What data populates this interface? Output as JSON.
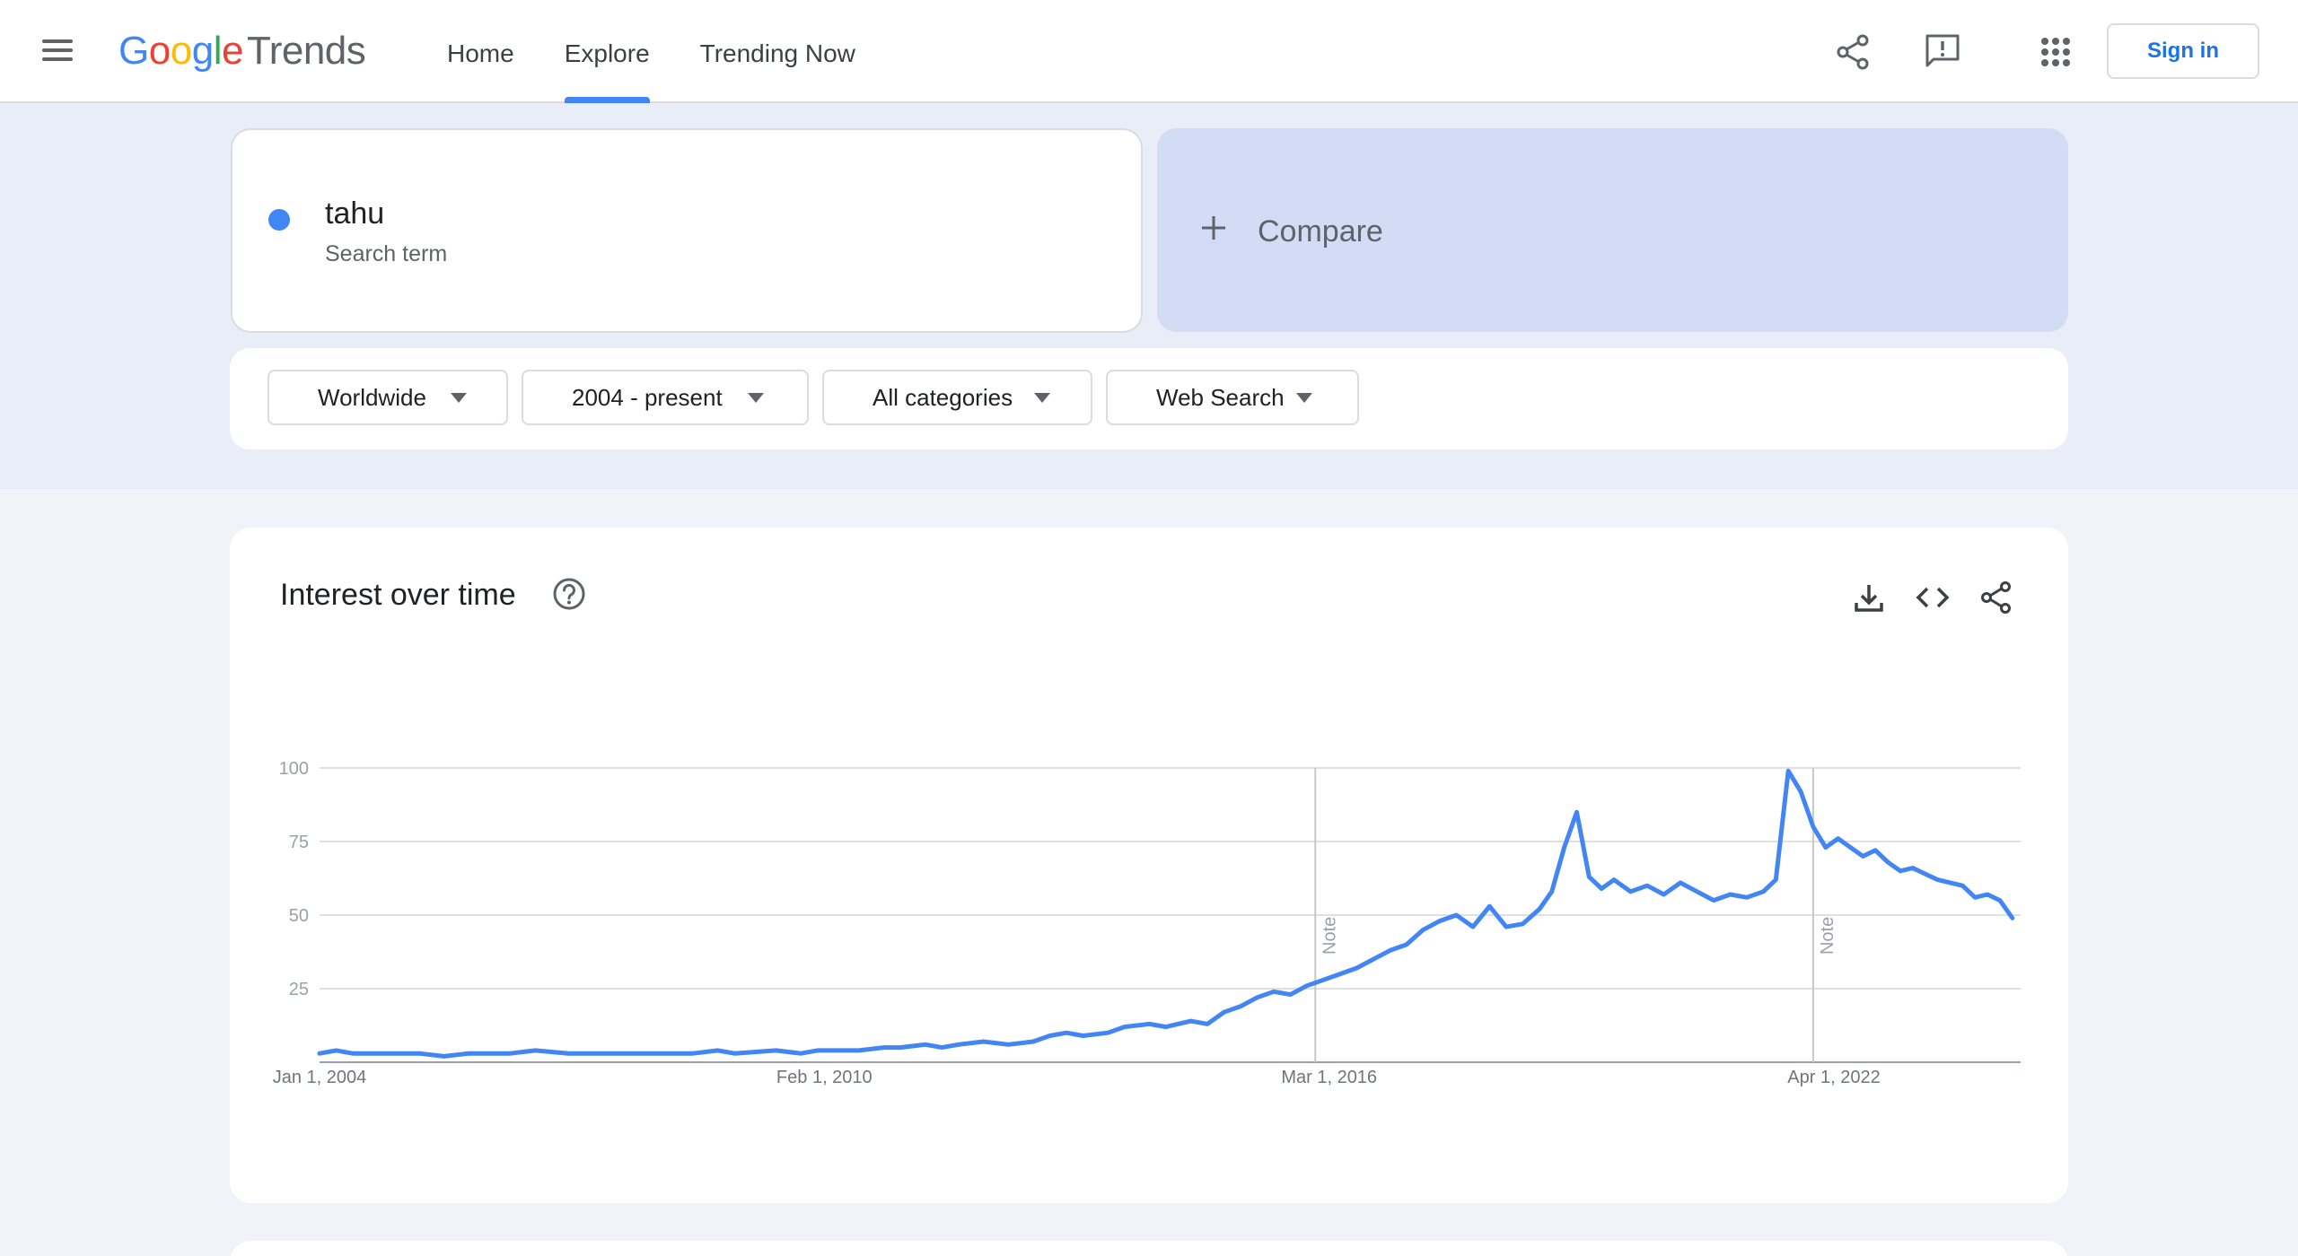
{
  "header": {
    "logo_google": [
      "G",
      "o",
      "o",
      "g",
      "l",
      "e"
    ],
    "logo_trends": "Trends",
    "nav": [
      {
        "label": "Home",
        "active": false
      },
      {
        "label": "Explore",
        "active": true
      },
      {
        "label": "Trending Now",
        "active": false
      }
    ],
    "signin_label": "Sign in"
  },
  "search": {
    "term": "tahu",
    "term_type": "Search term",
    "term_color": "#4285f4",
    "compare_label": "Compare",
    "compare_icon": "plus-icon"
  },
  "filters": [
    {
      "label": "Worldwide"
    },
    {
      "label": "2004 - present"
    },
    {
      "label": "All categories"
    },
    {
      "label": "Web Search"
    }
  ],
  "interest_card": {
    "title": "Interest over time",
    "icons": [
      "help-icon",
      "download-icon",
      "embed-code-icon",
      "share-icon"
    ]
  },
  "chart_data": {
    "type": "line",
    "title": "",
    "xlabel": "",
    "ylabel": "",
    "ylim": [
      0,
      100
    ],
    "yticks": [
      25,
      50,
      75,
      100
    ],
    "xtick_labels": [
      "Jan 1, 2004",
      "Feb 1, 2010",
      "Mar 1, 2016",
      "Apr 1, 2022"
    ],
    "xtick_years": [
      2004.0,
      2010.083,
      2016.167,
      2022.25
    ],
    "xlim": [
      2004.0,
      2024.5
    ],
    "grid": true,
    "annotations": [
      {
        "label": "Note",
        "x": 2016.0
      },
      {
        "label": "Note",
        "x": 2022.0
      }
    ],
    "series": [
      {
        "name": "tahu",
        "color": "#4285f4",
        "points": [
          [
            2004.0,
            3
          ],
          [
            2004.2,
            4
          ],
          [
            2004.4,
            3
          ],
          [
            2004.8,
            3
          ],
          [
            2005.2,
            3
          ],
          [
            2005.5,
            2
          ],
          [
            2005.8,
            3
          ],
          [
            2006.3,
            3
          ],
          [
            2006.6,
            4
          ],
          [
            2007.0,
            3
          ],
          [
            2007.5,
            3
          ],
          [
            2008.0,
            3
          ],
          [
            2008.5,
            3
          ],
          [
            2008.8,
            4
          ],
          [
            2009.0,
            3
          ],
          [
            2009.5,
            4
          ],
          [
            2009.8,
            3
          ],
          [
            2010.0,
            4
          ],
          [
            2010.5,
            4
          ],
          [
            2010.8,
            5
          ],
          [
            2011.0,
            5
          ],
          [
            2011.3,
            6
          ],
          [
            2011.5,
            5
          ],
          [
            2011.7,
            6
          ],
          [
            2012.0,
            7
          ],
          [
            2012.3,
            6
          ],
          [
            2012.6,
            7
          ],
          [
            2012.8,
            9
          ],
          [
            2013.0,
            10
          ],
          [
            2013.2,
            9
          ],
          [
            2013.5,
            10
          ],
          [
            2013.7,
            12
          ],
          [
            2014.0,
            13
          ],
          [
            2014.2,
            12
          ],
          [
            2014.5,
            14
          ],
          [
            2014.7,
            13
          ],
          [
            2014.9,
            17
          ],
          [
            2015.1,
            19
          ],
          [
            2015.3,
            22
          ],
          [
            2015.5,
            24
          ],
          [
            2015.7,
            23
          ],
          [
            2015.9,
            26
          ],
          [
            2016.1,
            28
          ],
          [
            2016.3,
            30
          ],
          [
            2016.5,
            32
          ],
          [
            2016.7,
            35
          ],
          [
            2016.9,
            38
          ],
          [
            2017.1,
            40
          ],
          [
            2017.3,
            45
          ],
          [
            2017.5,
            48
          ],
          [
            2017.7,
            50
          ],
          [
            2017.9,
            46
          ],
          [
            2018.1,
            53
          ],
          [
            2018.3,
            46
          ],
          [
            2018.5,
            47
          ],
          [
            2018.7,
            52
          ],
          [
            2018.85,
            58
          ],
          [
            2019.0,
            73
          ],
          [
            2019.15,
            85
          ],
          [
            2019.3,
            63
          ],
          [
            2019.45,
            59
          ],
          [
            2019.6,
            62
          ],
          [
            2019.8,
            58
          ],
          [
            2020.0,
            60
          ],
          [
            2020.2,
            57
          ],
          [
            2020.4,
            61
          ],
          [
            2020.6,
            58
          ],
          [
            2020.8,
            55
          ],
          [
            2021.0,
            57
          ],
          [
            2021.2,
            56
          ],
          [
            2021.4,
            58
          ],
          [
            2021.55,
            62
          ],
          [
            2021.7,
            99
          ],
          [
            2021.85,
            92
          ],
          [
            2022.0,
            80
          ],
          [
            2022.15,
            73
          ],
          [
            2022.3,
            76
          ],
          [
            2022.45,
            73
          ],
          [
            2022.6,
            70
          ],
          [
            2022.75,
            72
          ],
          [
            2022.9,
            68
          ],
          [
            2023.05,
            65
          ],
          [
            2023.2,
            66
          ],
          [
            2023.35,
            64
          ],
          [
            2023.5,
            62
          ],
          [
            2023.65,
            61
          ],
          [
            2023.8,
            60
          ],
          [
            2023.95,
            56
          ],
          [
            2024.1,
            57
          ],
          [
            2024.25,
            55
          ],
          [
            2024.4,
            49
          ]
        ]
      }
    ]
  }
}
